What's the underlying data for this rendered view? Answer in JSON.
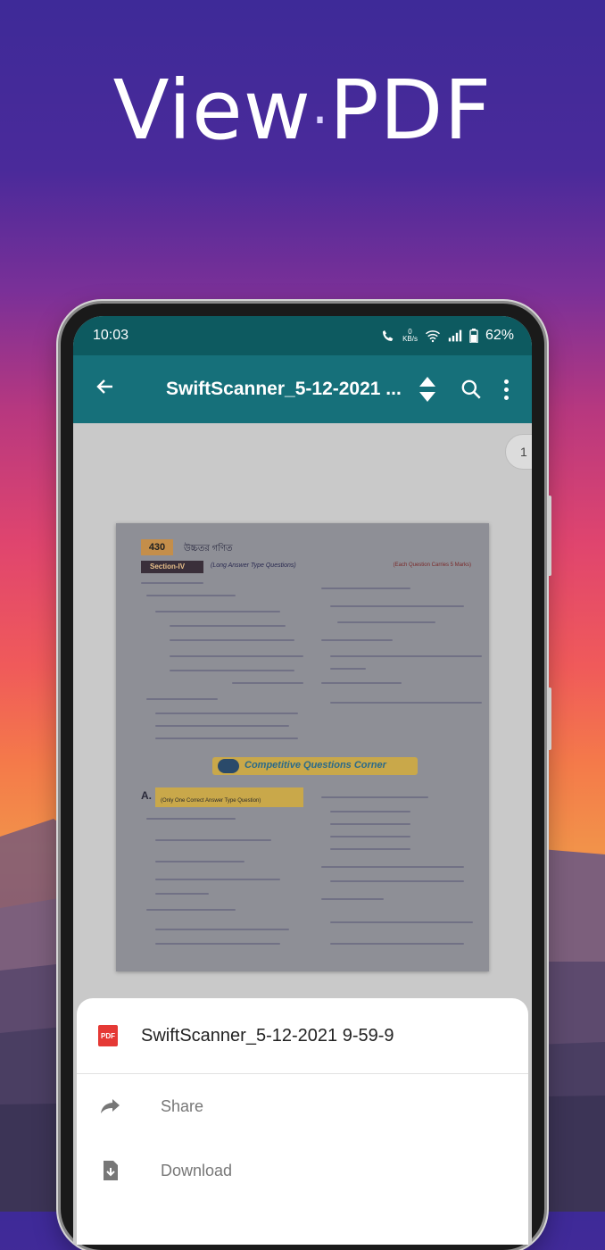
{
  "hero": {
    "word1": "View",
    "word2": "PDF"
  },
  "status_bar": {
    "time": "10:03",
    "net_speed_value": "0",
    "net_speed_unit": "KB/s",
    "battery": "62%"
  },
  "toolbar": {
    "title": "SwiftScanner_5-12-2021 ..."
  },
  "viewer": {
    "page_indicator": "1",
    "document": {
      "page_number": "430",
      "heading": "উচ্চতর গণিত",
      "section_tag": "Section-IV",
      "section_subtitle": "(Long Answer Type Questions)",
      "section_right": "(Each Question Carries 5 Marks)",
      "banner": "Competitive Questions Corner",
      "box_label": "A.",
      "box_text": "(Only One Correct Answer Type Question)"
    }
  },
  "bottom_sheet": {
    "file_name": "SwiftScanner_5-12-2021 9-59-9",
    "pdf_badge": "PDF",
    "actions": [
      {
        "label": "Share",
        "icon": "share-icon"
      },
      {
        "label": "Download",
        "icon": "download-icon"
      }
    ]
  },
  "colors": {
    "toolbar": "#16707a",
    "status_bar": "#0d5a60",
    "pdf_red": "#e53935"
  }
}
